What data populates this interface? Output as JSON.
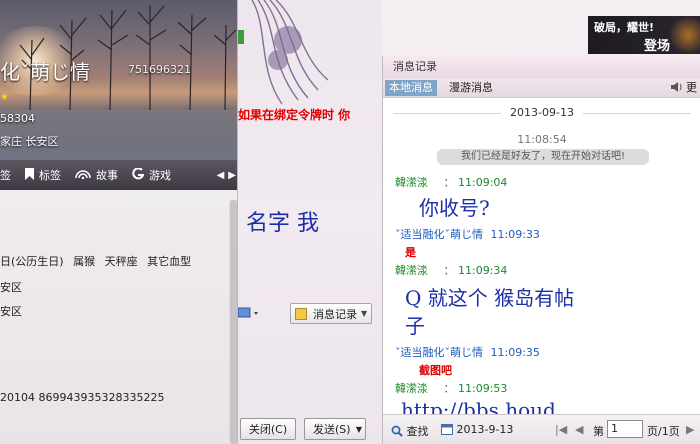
{
  "profile": {
    "nickname": "化ˇ萌じ情",
    "qq_number": "751696321",
    "number_line": "58304",
    "location": "家庄 长安区",
    "tabs": [
      {
        "label": "签",
        "icon": "tag-icon"
      },
      {
        "label": "标签",
        "icon": "bookmark-icon"
      },
      {
        "label": "故事",
        "icon": "wifi-icon"
      },
      {
        "label": "游戏",
        "icon": "game-icon"
      }
    ],
    "birthday_line": [
      "日(公历生日)",
      "属猴",
      "天秤座",
      "其它血型"
    ],
    "info_lines": [
      "安区",
      "安区"
    ],
    "id_line": "20104 869943935328335225"
  },
  "middle": {
    "red_text": "如果在绑定令牌时 你",
    "blue_text": "名字 我",
    "history_button": "消息记录",
    "close_button": "关闭(C)",
    "send_button": "发送(S)"
  },
  "chat": {
    "title": "消息记录",
    "tabs": [
      "本地消息",
      "漫游消息"
    ],
    "volume_label": "更",
    "date": "2013-09-13",
    "system_time": "11:08:54",
    "system_message": "我们已经是好友了，现在开始对话吧!",
    "messages": [
      {
        "sender": "韓潆渁",
        "time": "11:09:04",
        "text": "你收号?",
        "type": "big"
      },
      {
        "sender": "ˇ适当融化ˇ萌じ情",
        "time": "11:09:33",
        "text": "是",
        "type": "red"
      },
      {
        "sender": "韓潆渁",
        "time": "11:09:34",
        "text": "Q 就这个 猴岛有帖",
        "text2": "子",
        "type": "big"
      },
      {
        "sender": "ˇ适当融化ˇ萌じ情",
        "time": "11:09:35",
        "text": "截图吧",
        "type": "red"
      },
      {
        "sender": "韓潆渁",
        "time": "11:09:53",
        "text": "http://bbs.houd",
        "type": "big"
      }
    ],
    "footer": {
      "search": "查找",
      "date": "2013-9-13",
      "page_label": "第",
      "page_value": "1",
      "page_total": "页/1页"
    }
  },
  "banner": {
    "line1": "破局，耀世!",
    "line2": "登场"
  }
}
